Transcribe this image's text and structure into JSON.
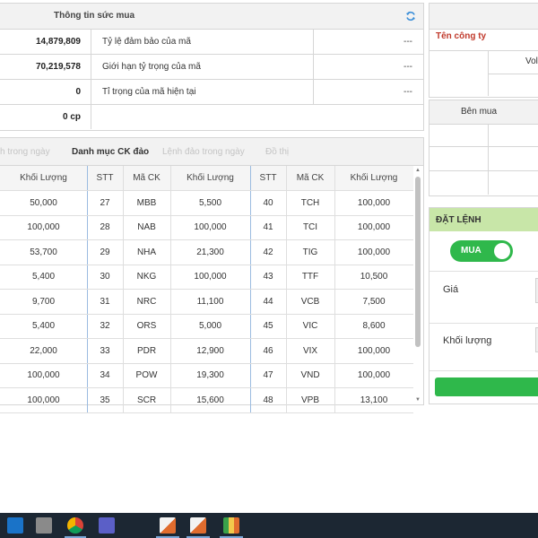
{
  "buying_power": {
    "title": "Thông tin sức mua",
    "refresh_icon": "refresh-icon",
    "rows": [
      {
        "value": "14,879,809",
        "label": "Tỷ lệ đảm bảo của mã",
        "extra": "---"
      },
      {
        "value": "70,219,578",
        "label": "Giới hạn tỷ trọng của mã",
        "extra": "---"
      },
      {
        "value": "0",
        "label": "Tỉ trọng của mã hiện tại",
        "extra": "---"
      },
      {
        "value": "0 cp",
        "label": "",
        "extra": ""
      }
    ]
  },
  "tabs": [
    {
      "label": "h trong ngày",
      "active": false
    },
    {
      "label": "Danh mục CK đảo",
      "active": true
    },
    {
      "label": "Lệnh đảo trong ngày",
      "active": false
    },
    {
      "label": "Đồ thị",
      "active": false
    }
  ],
  "table": {
    "headers": [
      "Khối Lượng",
      "STT",
      "Mã CK",
      "Khối Lượng",
      "STT",
      "Mã CK",
      "Khối Lượng"
    ],
    "rows": [
      [
        "50,000",
        "27",
        "MBB",
        "5,500",
        "40",
        "TCH",
        "100,000"
      ],
      [
        "100,000",
        "28",
        "NAB",
        "100,000",
        "41",
        "TCI",
        "100,000"
      ],
      [
        "53,700",
        "29",
        "NHA",
        "21,300",
        "42",
        "TIG",
        "100,000"
      ],
      [
        "5,400",
        "30",
        "NKG",
        "100,000",
        "43",
        "TTF",
        "10,500"
      ],
      [
        "9,700",
        "31",
        "NRC",
        "11,100",
        "44",
        "VCB",
        "7,500"
      ],
      [
        "5,400",
        "32",
        "ORS",
        "5,000",
        "45",
        "VIC",
        "8,600"
      ],
      [
        "22,000",
        "33",
        "PDR",
        "12,900",
        "46",
        "VIX",
        "100,000"
      ],
      [
        "100,000",
        "34",
        "POW",
        "19,300",
        "47",
        "VND",
        "100,000"
      ],
      [
        "100,000",
        "35",
        "SCR",
        "15,600",
        "48",
        "VPB",
        "13,100"
      ]
    ]
  },
  "company_panel": {
    "company_label": "Tên công ty",
    "vol_label": "Vol"
  },
  "book_panel": {
    "buy_label": "Bên mua"
  },
  "order": {
    "title": "ĐẶT LỆNH",
    "toggle_label": "MUA",
    "price_label": "Giá",
    "qty_label": "Khối lượng"
  },
  "taskbar_icons": [
    "outlook-icon",
    "calculator-icon",
    "chrome-icon",
    "teams-icon",
    "app-window-icon",
    "app-window-icon",
    "app-window-icon"
  ]
}
